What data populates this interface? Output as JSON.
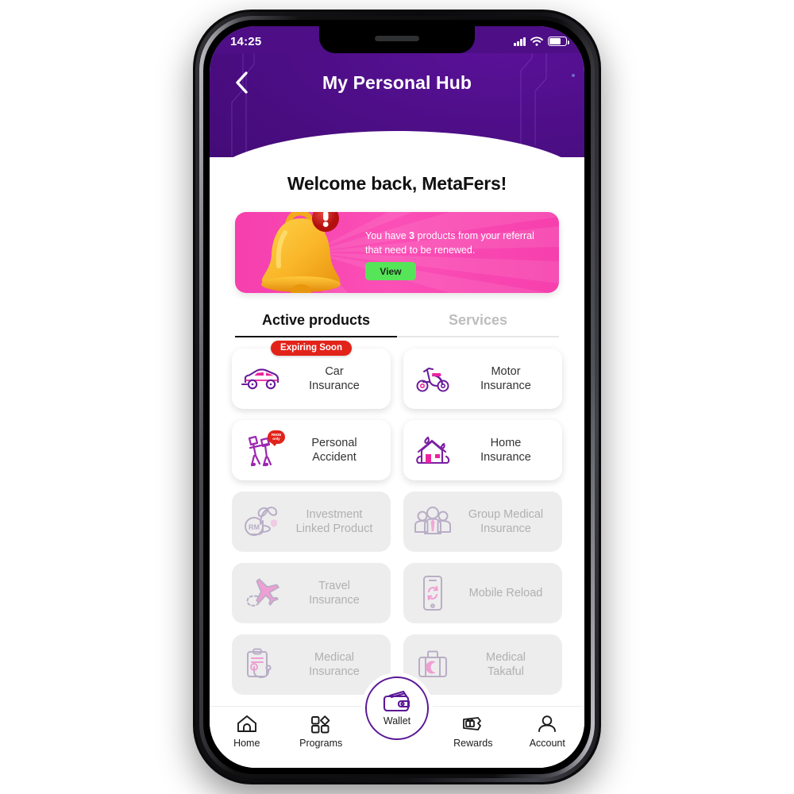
{
  "statusbar": {
    "time": "14:25",
    "signal_icon": "cellular-bars-icon",
    "wifi_icon": "wifi-icon",
    "battery_icon": "battery-icon"
  },
  "header": {
    "back_icon": "chevron-left-icon",
    "title": "My Personal Hub"
  },
  "welcome": {
    "text": "Welcome back, MetaFers!"
  },
  "banner": {
    "icon": "bell-icon",
    "alert_icon": "exclamation-badge-icon",
    "message_prefix": "You have ",
    "count": "3",
    "message_suffix": " products from your referral that need to be renewed.",
    "cta_label": "View",
    "bg_color": "#FA47B1",
    "cta_color": "#56E558"
  },
  "tabs": [
    {
      "label": "Active products",
      "active": true
    },
    {
      "label": "Services",
      "active": false
    }
  ],
  "products": [
    {
      "label": "Car\nInsurance",
      "icon": "car-icon",
      "disabled": false,
      "badge": "Expiring Soon",
      "badge_type": "pill"
    },
    {
      "label": "Motor\nInsurance",
      "icon": "scooter-icon",
      "disabled": false,
      "badge": null,
      "badge_type": null
    },
    {
      "label": "Personal\nAccident",
      "icon": "crutches-icon",
      "disabled": false,
      "badge": "RM36\nonly",
      "badge_type": "mini"
    },
    {
      "label": "Home\nInsurance",
      "icon": "house-icon",
      "disabled": false,
      "badge": null,
      "badge_type": null
    },
    {
      "label": "Investment\nLinked Product",
      "icon": "coins-plant-icon",
      "disabled": true,
      "badge": null,
      "badge_type": null
    },
    {
      "label": "Group Medical\nInsurance",
      "icon": "people-group-icon",
      "disabled": true,
      "badge": null,
      "badge_type": null
    },
    {
      "label": "Travel\nInsurance",
      "icon": "airplane-icon",
      "disabled": true,
      "badge": null,
      "badge_type": null
    },
    {
      "label": "Mobile Reload",
      "icon": "phone-refresh-icon",
      "disabled": true,
      "badge": null,
      "badge_type": null
    },
    {
      "label": "Medical\nInsurance",
      "icon": "clipboard-stethoscope-icon",
      "disabled": true,
      "badge": null,
      "badge_type": null
    },
    {
      "label": "Medical\nTakaful",
      "icon": "suitcase-crescent-icon",
      "disabled": true,
      "badge": null,
      "badge_type": null
    }
  ],
  "bottom_nav": [
    {
      "label": "Home",
      "icon": "home-icon"
    },
    {
      "label": "Programs",
      "icon": "grid-shapes-icon"
    },
    {
      "label": "Wallet",
      "icon": "wallet-icon",
      "featured": true
    },
    {
      "label": "Rewards",
      "icon": "gift-ticket-icon"
    },
    {
      "label": "Account",
      "icon": "person-icon"
    }
  ],
  "theme": {
    "purple": "#4D0E86",
    "pink": "#FA47B1",
    "green": "#56E558",
    "red": "#E2231A",
    "accent_purple": "#5B1896"
  }
}
